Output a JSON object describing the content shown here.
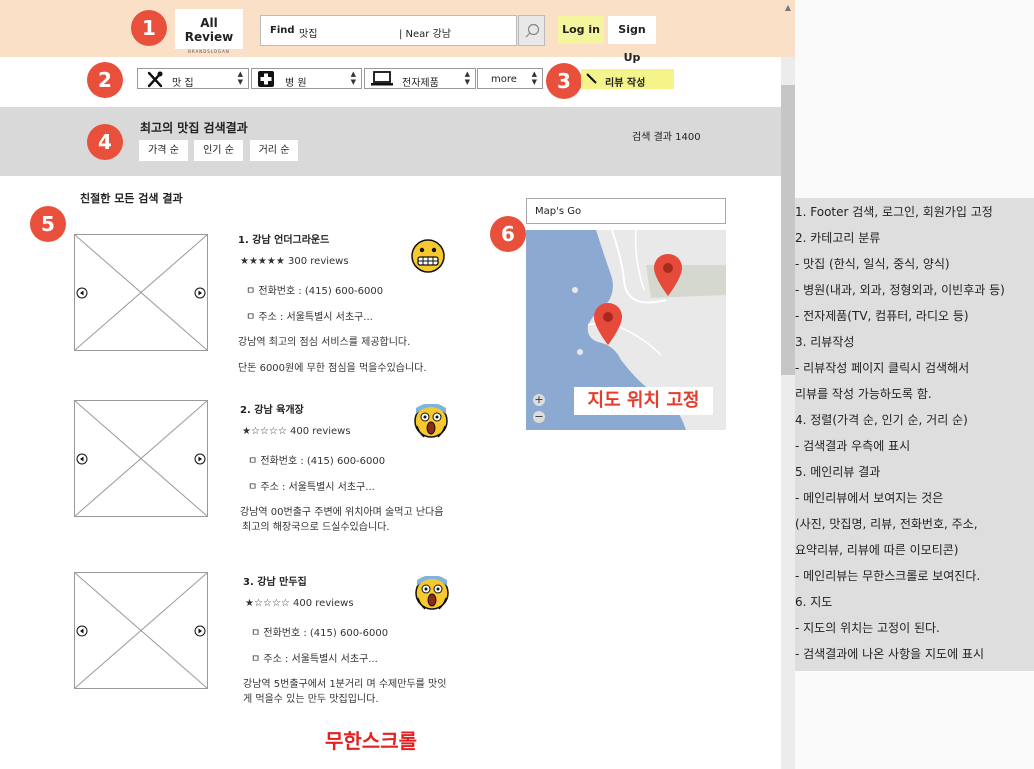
{
  "header": {
    "logo_text": "All Review",
    "logo_slogan": "BRANDSLOGAN",
    "search_find": "Find",
    "search_category": "맛집",
    "search_near": "| Near 강남",
    "login_label": "Log in",
    "signup_label": "Sign Up"
  },
  "badges": [
    "1",
    "2",
    "3",
    "4",
    "5",
    "6"
  ],
  "categories": [
    {
      "label": "맛 집",
      "icon": "fork-knife-icon"
    },
    {
      "label": "병 원",
      "icon": "hospital-cross-icon"
    },
    {
      "label": "전자제품",
      "icon": "laptop-icon"
    },
    {
      "label": "more",
      "icon": ""
    }
  ],
  "write_review_label": "리뷰 작성",
  "sort": {
    "title": "최고의 맛집 검색결과",
    "count_text": "검색 결과  1400",
    "buttons": [
      "가격 순",
      "인기 순",
      "거리 순"
    ]
  },
  "results": {
    "heading": "친절한 모든 검색 결과",
    "items": [
      {
        "title": "1. 강남 언더그라운드",
        "stars": "★★★★★ 300 reviews",
        "phone": "ㅁ 전화번호 : (415) 600-6000",
        "address": "ㅁ 주소 : 서울특별시 서초구...",
        "desc1": "강남역 최고의 점심 서비스를 제공합니다.",
        "desc2": "단돈 6000원에 무한 점심을 먹을수있습니다.",
        "emoji": "grinning-face-icon"
      },
      {
        "title": "2. 강남  육개장",
        "stars": "★☆☆☆☆ 400 reviews",
        "phone": "ㅁ 전화번호 : (415) 600-6000",
        "address": "ㅁ 주소 : 서울특별시 서초구...",
        "desc1": "강남역 00번출구 주변에 위치아며 술먹고 난다음",
        "desc2": "최고의 해장국으로 드실수있습니다.",
        "emoji": "screaming-face-icon"
      },
      {
        "title": "3. 강남 만두집",
        "stars": "★☆☆☆☆ 400 reviews",
        "phone": "ㅁ 전화번호 : (415) 600-6000",
        "address": "ㅁ 주소 : 서울특별시 서초구...",
        "desc1": "강남역 5번출구에서 1분거리 며 수제만두를 맛잇",
        "desc2": "게 먹을수 있는 만두 맛집입니다.",
        "emoji": "screaming-face-icon"
      }
    ],
    "infinite_scroll_label": "무한스크롤"
  },
  "map": {
    "search_placeholder": "Map's Go",
    "fixed_label": "지도 위치 고정",
    "zoom_in": "+",
    "zoom_out": "−",
    "colors": {
      "water": "#8ca9d1",
      "land": "#e9e9e9",
      "pin": "#e64a3a"
    }
  },
  "notes": [
    "1. Footer 검색, 로그인, 회원가입 고정",
    "2. 카테고리 분류",
    " - 맛집 (한식, 일식, 중식, 양식)",
    " - 병원(내과, 외과, 정형외과, 이빈후과 등)",
    " - 전자제품(TV, 컴퓨터, 라디오 등)",
    "3. 리뷰작성",
    "  - 리뷰작성 페이지 클릭시 검색해서",
    "    리뷰를 작성 가능하도록 함.",
    "4. 정렬(가격 순, 인기 순, 거리 순)",
    " - 검색결과 우측에 표시",
    "5. 메인리뷰 결과",
    " - 메인리뷰에서 보여지는 것은",
    "   (사진, 맛집명, 리뷰, 전화번호, 주소,",
    "     요약리뷰, 리뷰에 따른 이모티콘)",
    " -  메인리뷰는 무한스크롤로 보여진다.",
    "6. 지도",
    " - 지도의 위치는 고정이 된다.",
    " - 검색결과에 나온 사항을 지도에 표시"
  ]
}
